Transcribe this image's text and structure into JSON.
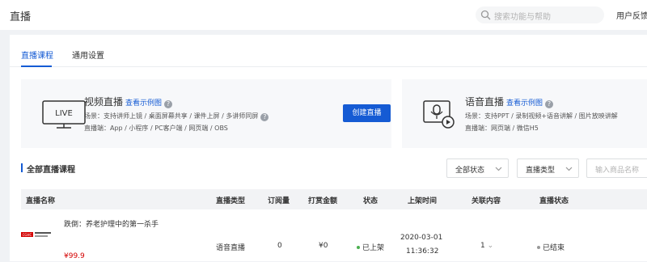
{
  "topbar": {
    "title": "直播",
    "search_placeholder": "搜索功能与帮助",
    "feedback": "用户反馈"
  },
  "tabs": [
    {
      "label": "直播课程",
      "active": true
    },
    {
      "label": "通用设置",
      "active": false
    }
  ],
  "cards": [
    {
      "icon": "live-screen-icon",
      "icon_text": "LIVE",
      "title": "视频直播",
      "example_link": "查看示例图",
      "scene": "场景：支持讲师上镜 / 桌面屏幕共享 / 课件上屏 / 多讲师同屏",
      "platforms": "直播端：App / 小程序 / PC客户端 / 网页端 / OBS",
      "button": "创建直播"
    },
    {
      "icon": "voice-live-icon",
      "title": "语音直播",
      "example_link": "查看示例图",
      "scene": "场景：支持PPT / 录制视频+语音讲解 / 图片放映讲解",
      "platforms": "直播端：网页端 / 微信H5"
    }
  ],
  "section": {
    "title": "全部直播课程",
    "status_filter": "全部状态",
    "type_filter": "直播类型",
    "product_search_placeholder": "输入商品名称"
  },
  "table": {
    "columns": [
      "直播名称",
      "直播类型",
      "订阅量",
      "打赏金额",
      "状态",
      "上架时间",
      "关联内容",
      "直播状态"
    ],
    "rows": [
      {
        "thumb_text": "CGHC",
        "name": "跌倒：养老护理中的第一杀手",
        "price": "¥99.9",
        "type": "语音直播",
        "subscriptions": "0",
        "reward": "¥0",
        "status": "已上架",
        "listed_date": "2020-03-01",
        "listed_time": "11:36:32",
        "related": "1",
        "live_status": "已结束"
      }
    ]
  },
  "colors": {
    "accent": "#155bd4",
    "status_green": "#4caf50",
    "status_grey": "#999999",
    "price_red": "#d40000"
  }
}
